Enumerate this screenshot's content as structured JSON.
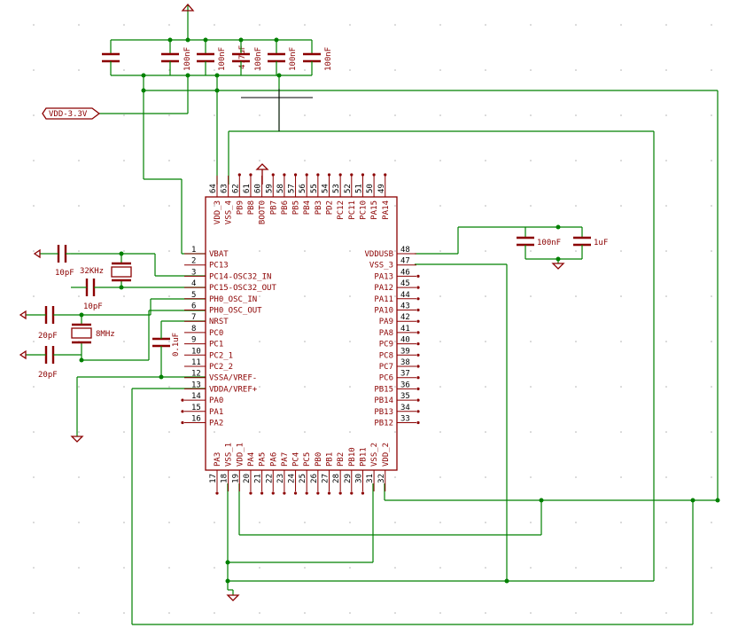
{
  "net": {
    "vdd": "VDD-3.3V"
  },
  "chip": {
    "left_pins": [
      {
        "num": "1",
        "name": "VBAT"
      },
      {
        "num": "2",
        "name": "PC13"
      },
      {
        "num": "3",
        "name": "PC14-OSC32_IN"
      },
      {
        "num": "4",
        "name": "PC15-OSC32_OUT"
      },
      {
        "num": "5",
        "name": "PH0_OSC_IN"
      },
      {
        "num": "6",
        "name": "PH0_OSC_OUT"
      },
      {
        "num": "7",
        "name": "NRST"
      },
      {
        "num": "8",
        "name": "PC0"
      },
      {
        "num": "9",
        "name": "PC1"
      },
      {
        "num": "10",
        "name": "PC2_1"
      },
      {
        "num": "11",
        "name": "PC2_2"
      },
      {
        "num": "12",
        "name": "VSSA/VREF-"
      },
      {
        "num": "13",
        "name": "VDDA/VREF+"
      },
      {
        "num": "14",
        "name": "PA0"
      },
      {
        "num": "15",
        "name": "PA1"
      },
      {
        "num": "16",
        "name": "PA2"
      }
    ],
    "right_pins": [
      {
        "num": "48",
        "name": "VDDUSB"
      },
      {
        "num": "47",
        "name": "VSS_3"
      },
      {
        "num": "46",
        "name": "PA13"
      },
      {
        "num": "45",
        "name": "PA12"
      },
      {
        "num": "44",
        "name": "PA11"
      },
      {
        "num": "43",
        "name": "PA10"
      },
      {
        "num": "42",
        "name": "PA9"
      },
      {
        "num": "41",
        "name": "PA8"
      },
      {
        "num": "40",
        "name": "PC9"
      },
      {
        "num": "39",
        "name": "PC8"
      },
      {
        "num": "38",
        "name": "PC7"
      },
      {
        "num": "37",
        "name": "PC6"
      },
      {
        "num": "36",
        "name": "PB15"
      },
      {
        "num": "35",
        "name": "PB14"
      },
      {
        "num": "34",
        "name": "PB13"
      },
      {
        "num": "33",
        "name": "PB12"
      }
    ],
    "top_pins": [
      {
        "num": "64",
        "name": "VDD_3"
      },
      {
        "num": "63",
        "name": "VSS_4"
      },
      {
        "num": "62",
        "name": "PB9"
      },
      {
        "num": "61",
        "name": "PB8"
      },
      {
        "num": "60",
        "name": "BOOT0"
      },
      {
        "num": "59",
        "name": "PB7"
      },
      {
        "num": "58",
        "name": "PB6"
      },
      {
        "num": "57",
        "name": "PB5"
      },
      {
        "num": "56",
        "name": "PB4"
      },
      {
        "num": "55",
        "name": "PB3"
      },
      {
        "num": "54",
        "name": "PD2"
      },
      {
        "num": "53",
        "name": "PC12"
      },
      {
        "num": "52",
        "name": "PC11"
      },
      {
        "num": "51",
        "name": "PC10"
      },
      {
        "num": "50",
        "name": "PA15"
      },
      {
        "num": "49",
        "name": "PA14"
      }
    ],
    "bottom_pins": [
      {
        "num": "17",
        "name": "PA3"
      },
      {
        "num": "18",
        "name": "VSS_1"
      },
      {
        "num": "19",
        "name": "VDD_1"
      },
      {
        "num": "20",
        "name": "PA4"
      },
      {
        "num": "21",
        "name": "PA5"
      },
      {
        "num": "22",
        "name": "PA6"
      },
      {
        "num": "23",
        "name": "PA7"
      },
      {
        "num": "24",
        "name": "PC4"
      },
      {
        "num": "25",
        "name": "PC5"
      },
      {
        "num": "26",
        "name": "PB0"
      },
      {
        "num": "27",
        "name": "PB1"
      },
      {
        "num": "28",
        "name": "PB2"
      },
      {
        "num": "29",
        "name": "PB10"
      },
      {
        "num": "30",
        "name": "PB11"
      },
      {
        "num": "31",
        "name": "VSS_2"
      },
      {
        "num": "32",
        "name": "VDD_2"
      }
    ]
  },
  "caps": {
    "c_top1": "4.7uF",
    "c_top2": "100nF",
    "c_top3": "100nF",
    "c_top4": "100nF",
    "c_top5": "100nF",
    "c_top6": "100nF",
    "c_usb1": "100nF",
    "c_usb2": "1uF",
    "c_osc32a": "10pF",
    "c_osc32b": "10pF",
    "c_osc8a": "20pF",
    "c_osc8b": "20pF",
    "c_nrst": "0.1uF"
  },
  "crystals": {
    "x32": "32KHz",
    "x8": "8MHz"
  }
}
